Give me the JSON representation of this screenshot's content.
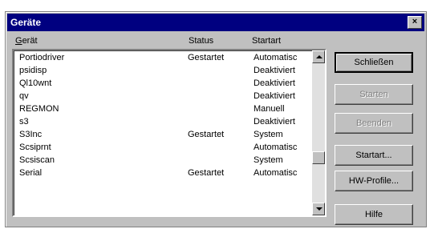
{
  "window": {
    "title": "Geräte",
    "close_label": "×"
  },
  "columns": {
    "device": "Gerät",
    "status": "Status",
    "start": "Startart"
  },
  "rows": [
    {
      "name": "Portiodriver",
      "status": "Gestartet",
      "start": "Automatisc"
    },
    {
      "name": "psidisp",
      "status": "",
      "start": "Deaktiviert"
    },
    {
      "name": "Ql10wnt",
      "status": "",
      "start": "Deaktiviert"
    },
    {
      "name": "qv",
      "status": "",
      "start": "Deaktiviert"
    },
    {
      "name": "REGMON",
      "status": "",
      "start": "Manuell"
    },
    {
      "name": "s3",
      "status": "",
      "start": "Deaktiviert"
    },
    {
      "name": "S3Inc",
      "status": "Gestartet",
      "start": "System"
    },
    {
      "name": "Scsiprnt",
      "status": "",
      "start": "Automatisc"
    },
    {
      "name": "Scsiscan",
      "status": "",
      "start": "System"
    },
    {
      "name": "Serial",
      "status": "Gestartet",
      "start": "Automatisc"
    }
  ],
  "buttons": {
    "close": "Schließen",
    "start": "Starten",
    "stop": "Beenden",
    "startup": "Startart...",
    "hw_profiles": "HW-Profile...",
    "help": "Hilfe"
  },
  "colors": {
    "titlebar": "#000080",
    "face": "#c0c0c0"
  }
}
